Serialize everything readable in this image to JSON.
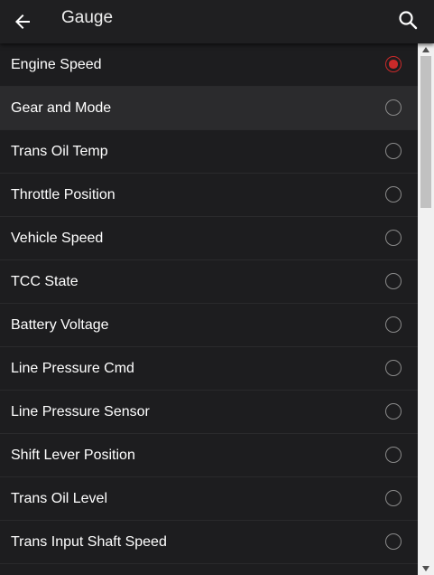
{
  "header": {
    "title": "Gauge",
    "back_icon": "arrow-left-icon",
    "search_icon": "search-icon"
  },
  "list": {
    "selected_index": 0,
    "highlighted_index": 1,
    "items": [
      {
        "label": "Engine Speed"
      },
      {
        "label": "Gear and Mode"
      },
      {
        "label": "Trans Oil Temp"
      },
      {
        "label": "Throttle Position"
      },
      {
        "label": "Vehicle Speed"
      },
      {
        "label": "TCC State"
      },
      {
        "label": "Battery Voltage"
      },
      {
        "label": "Line Pressure Cmd"
      },
      {
        "label": "Line Pressure Sensor"
      },
      {
        "label": "Shift Lever Position"
      },
      {
        "label": "Trans Oil Level"
      },
      {
        "label": "Trans Input Shaft Speed"
      }
    ]
  },
  "colors": {
    "background": "#1d1d1f",
    "header": "#1f1f21",
    "highlight_row": "#2b2b2d",
    "accent_selected": "#c92a2a",
    "radio_unselected": "#8a8a8a",
    "text": "#ffffff",
    "scrollbar_track": "#f1f1f1",
    "scrollbar_thumb": "#c1c1c1"
  },
  "scrollbar": {
    "position_fraction": 0.0,
    "visible_fraction": 0.3
  }
}
